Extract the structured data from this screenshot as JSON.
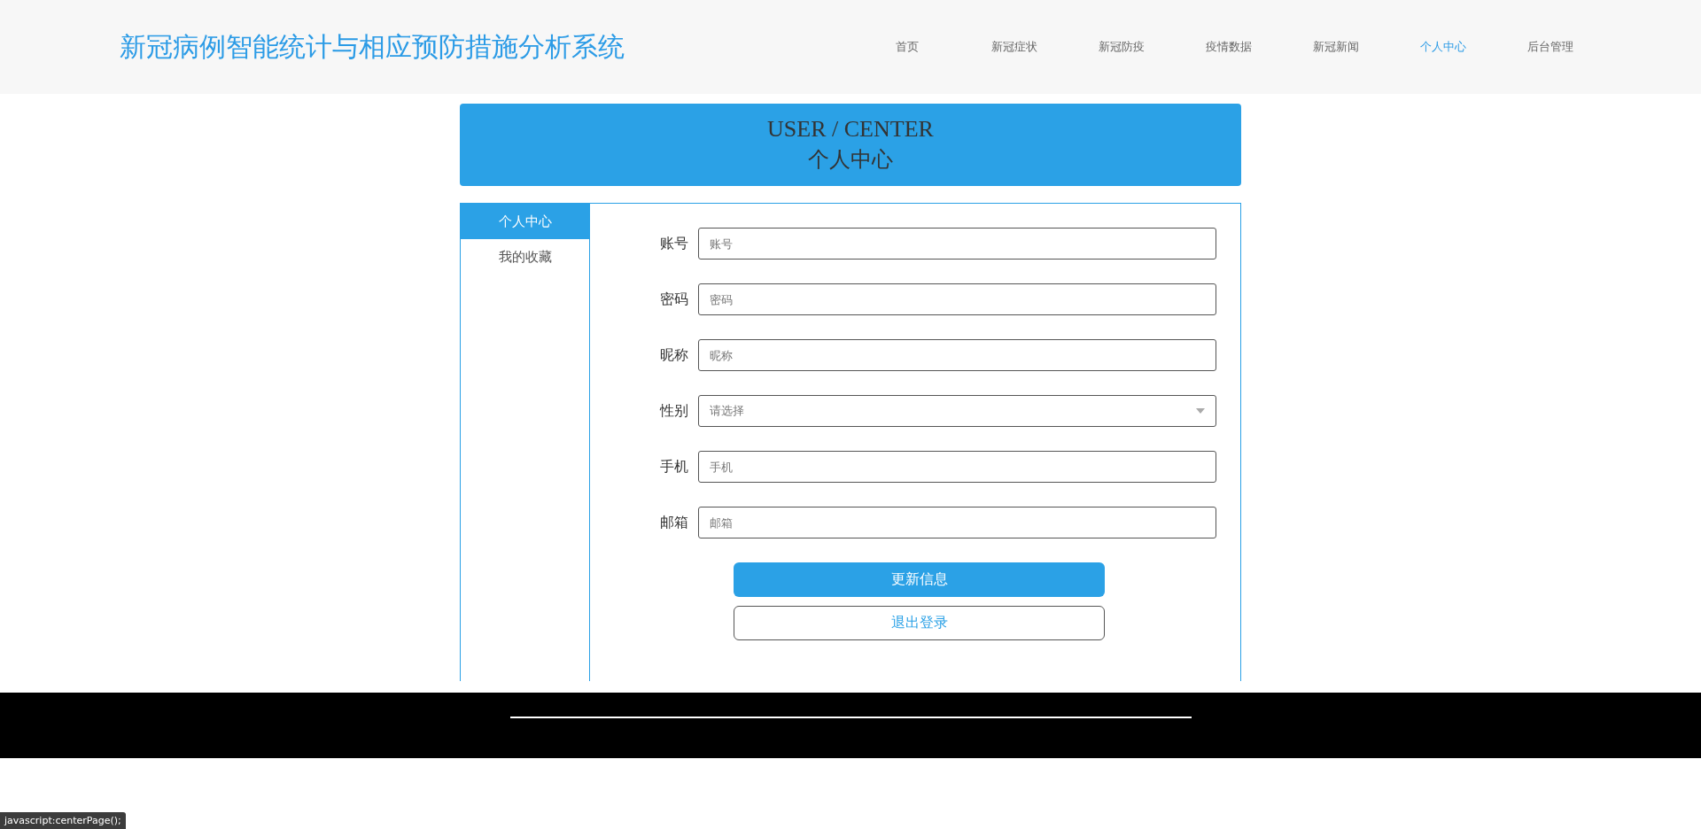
{
  "header": {
    "title": "新冠病例智能统计与相应预防措施分析系统",
    "nav": [
      {
        "label": "首页",
        "selected": false
      },
      {
        "label": "新冠症状",
        "selected": false
      },
      {
        "label": "新冠防疫",
        "selected": false
      },
      {
        "label": "疫情数据",
        "selected": false
      },
      {
        "label": "新冠新闻",
        "selected": false
      },
      {
        "label": "个人中心",
        "selected": true
      },
      {
        "label": "后台管理",
        "selected": false
      }
    ]
  },
  "banner": {
    "title": "USER / CENTER",
    "subtitle": "个人中心"
  },
  "sidebar": {
    "items": [
      {
        "label": "个人中心",
        "selected": true
      },
      {
        "label": "我的收藏",
        "selected": false
      }
    ]
  },
  "form": {
    "fields": [
      {
        "kind": "text",
        "label": "账号",
        "placeholder": "账号"
      },
      {
        "kind": "text",
        "label": "密码",
        "placeholder": "密码"
      },
      {
        "kind": "text",
        "label": "昵称",
        "placeholder": "昵称"
      },
      {
        "kind": "select",
        "label": "性别",
        "placeholder": "请选择"
      },
      {
        "kind": "text",
        "label": "手机",
        "placeholder": "手机"
      },
      {
        "kind": "text",
        "label": "邮箱",
        "placeholder": "邮箱"
      }
    ],
    "buttons": [
      {
        "kind": "primary",
        "label": "更新信息"
      },
      {
        "kind": "outline",
        "label": "退出登录"
      }
    ]
  },
  "status_bar": {
    "url": "javascript:centerPage();"
  }
}
